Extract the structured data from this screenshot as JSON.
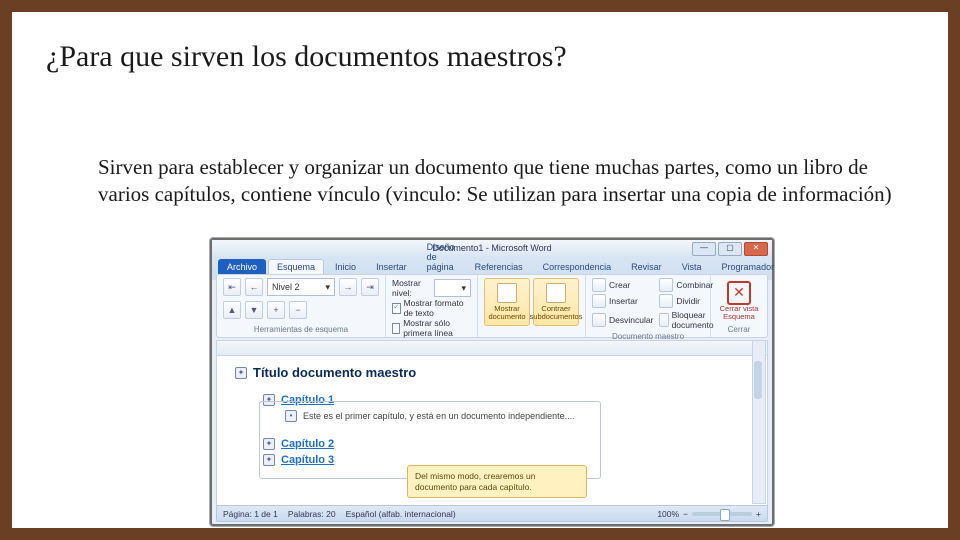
{
  "slide": {
    "title": "¿Para que sirven los documentos maestros?",
    "body": "Sirven para establecer y organizar un documento que tiene muchas partes, como un libro de varios capítulos, contiene vínculo (vinculo: Se utilizan para insertar una copia de información)"
  },
  "word": {
    "window_title": "Documento1 - Microsoft Word",
    "tabs": {
      "file": "Archivo",
      "outline": "Esquema",
      "home": "Inicio",
      "insert": "Insertar",
      "layout": "Diseño de página",
      "references": "Referencias",
      "mail": "Correspondencia",
      "review": "Revisar",
      "view": "Vista",
      "dev": "Programador"
    },
    "level_value": "Nivel 2",
    "show_level_label": "Mostrar nivel:",
    "chk_text_format": "Mostrar formato de texto",
    "chk_first_line": "Mostrar sólo primera línea",
    "group_tools": "Herramientas de esquema",
    "btn_show_doc": "Mostrar documento",
    "btn_collapse_sub": "Contraer subdocumentos",
    "master": {
      "create": "Crear",
      "insert": "Insertar",
      "merge": "Combinar",
      "split": "Dividir",
      "unlink": "Desvincular",
      "lock": "Bloquear documento"
    },
    "group_master": "Documento maestro",
    "close_outline": "Cerrar vista Esquema",
    "group_close": "Cerrar",
    "doc": {
      "title": "Título documento maestro",
      "ch1": "Capítulo 1",
      "ch1_sub": "Este es el primer capítulo, y está en un documento independiente....",
      "ch2": "Capítulo 2",
      "ch3": "Capítulo 3",
      "callout": "Del mismo modo, crearemos un documento para cada capítulo."
    },
    "status": {
      "page": "Página: 1 de 1",
      "words": "Palabras: 20",
      "lang": "Español (alfab. internacional)",
      "zoom": "100%"
    }
  }
}
